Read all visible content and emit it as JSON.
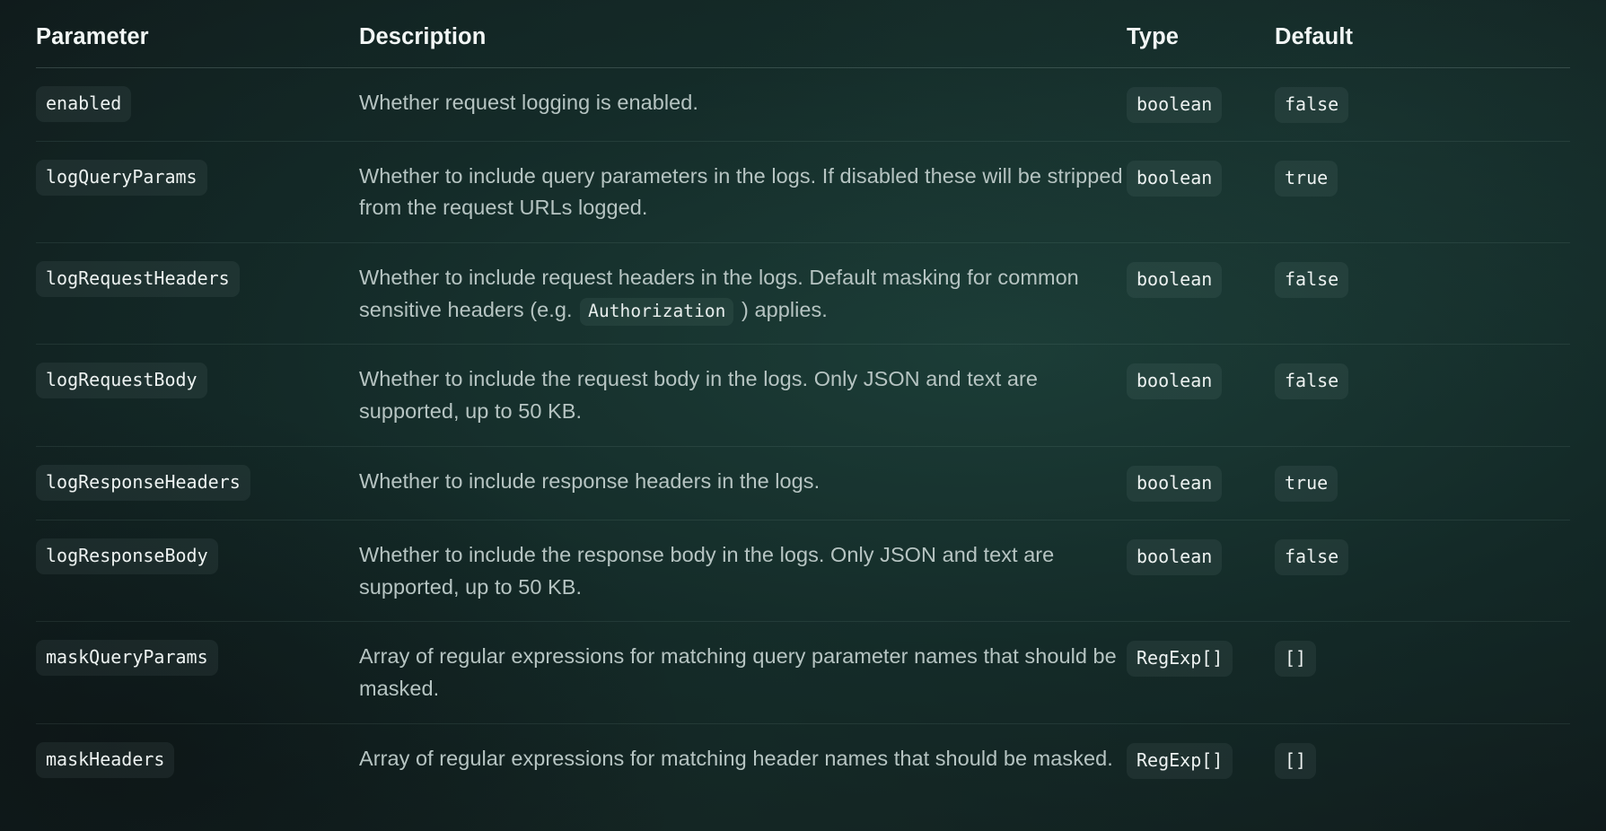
{
  "table": {
    "headers": {
      "parameter": "Parameter",
      "description": "Description",
      "type": "Type",
      "default": "Default"
    },
    "rows": [
      {
        "parameter": "enabled",
        "description_parts": [
          {
            "kind": "text",
            "value": "Whether request logging is enabled."
          }
        ],
        "description_plain": "Whether request logging is enabled.",
        "type": "boolean",
        "default": "false"
      },
      {
        "parameter": "logQueryParams",
        "description_parts": [
          {
            "kind": "text",
            "value": "Whether to include query parameters in the logs. If disabled these will be stripped from the request URLs logged."
          }
        ],
        "description_plain": "Whether to include query parameters in the logs. If disabled these will be stripped from the request URLs logged.",
        "type": "boolean",
        "default": "true"
      },
      {
        "parameter": "logRequestHeaders",
        "description_parts": [
          {
            "kind": "text",
            "value": "Whether to include request headers in the logs. Default masking for common sensitive headers (e.g. "
          },
          {
            "kind": "code",
            "value": "Authorization"
          },
          {
            "kind": "text",
            "value": " ) applies."
          }
        ],
        "description_plain": "Whether to include request headers in the logs. Default masking for common sensitive headers (e.g. Authorization ) applies.",
        "type": "boolean",
        "default": "false"
      },
      {
        "parameter": "logRequestBody",
        "description_parts": [
          {
            "kind": "text",
            "value": "Whether to include the request body in the logs. Only JSON and text are supported, up to 50 KB."
          }
        ],
        "description_plain": "Whether to include the request body in the logs. Only JSON and text are supported, up to 50 KB.",
        "type": "boolean",
        "default": "false"
      },
      {
        "parameter": "logResponseHeaders",
        "description_parts": [
          {
            "kind": "text",
            "value": "Whether to include response headers in the logs."
          }
        ],
        "description_plain": "Whether to include response headers in the logs.",
        "type": "boolean",
        "default": "true"
      },
      {
        "parameter": "logResponseBody",
        "description_parts": [
          {
            "kind": "text",
            "value": "Whether to include the response body in the logs. Only JSON and text are supported, up to 50 KB."
          }
        ],
        "description_plain": "Whether to include the response body in the logs. Only JSON and text are supported, up to 50 KB.",
        "type": "boolean",
        "default": "false"
      },
      {
        "parameter": "maskQueryParams",
        "description_parts": [
          {
            "kind": "text",
            "value": "Array of regular expressions for matching query parameter names that should be masked."
          }
        ],
        "description_plain": "Array of regular expressions for matching query parameter names that should be masked.",
        "type": "RegExp[]",
        "default": "[]"
      },
      {
        "parameter": "maskHeaders",
        "description_parts": [
          {
            "kind": "text",
            "value": "Array of regular expressions for matching header names that should be masked."
          }
        ],
        "description_plain": "Array of regular expressions for matching header names that should be masked.",
        "type": "RegExp[]",
        "default": "[]"
      }
    ]
  },
  "colors": {
    "background_dark": "#101819",
    "background_teal": "#162724",
    "header_text": "#f2f6f5",
    "description_text": "#b6c4c2",
    "pill_text": "#edf2f1",
    "divider": "rgba(150,180,172,0.12)"
  }
}
